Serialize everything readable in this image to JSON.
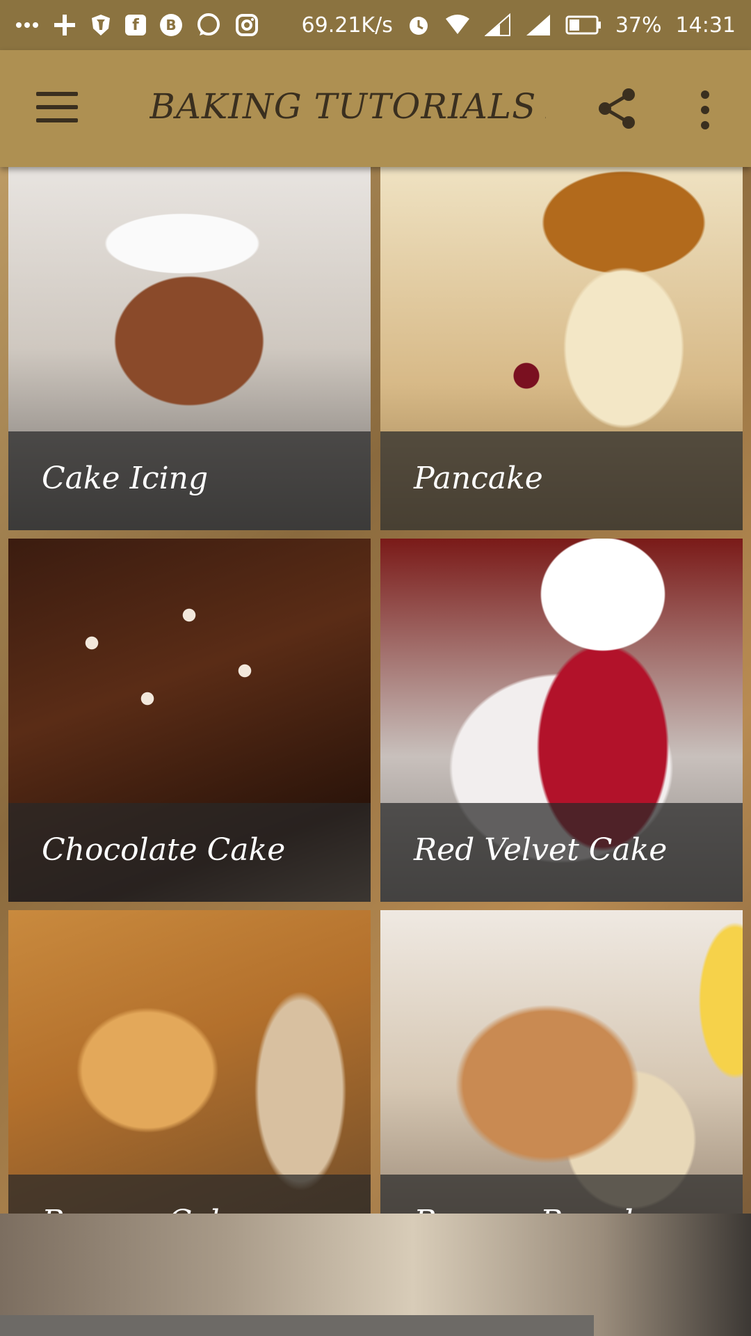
{
  "status_bar": {
    "icons_left": [
      "more-icon",
      "plus-icon",
      "shield-icon",
      "flipboard-icon",
      "bitcoin-icon",
      "whatsapp-icon",
      "instagram-icon"
    ],
    "speed": "69.21K/s",
    "icons_right": [
      "alarm-icon",
      "wifi-icon",
      "signal-icon",
      "signal-icon",
      "battery-icon"
    ],
    "battery": "37%",
    "time": "14:31"
  },
  "app_bar": {
    "title": "BAKING TUTORIALS A...",
    "menu_icon": "menu-icon",
    "share_icon": "share-icon",
    "more_icon": "more-vert-icon"
  },
  "grid": {
    "items": [
      {
        "label": "Cake Icing"
      },
      {
        "label": "Pancake"
      },
      {
        "label": "Chocolate Cake"
      },
      {
        "label": "Red Velvet Cake"
      },
      {
        "label": "Banana Cake"
      },
      {
        "label": "Banana Bread"
      }
    ]
  },
  "colors": {
    "status_bar": "#8b7340",
    "app_bar": "#ae9052",
    "title_text": "#3a2f1f"
  }
}
